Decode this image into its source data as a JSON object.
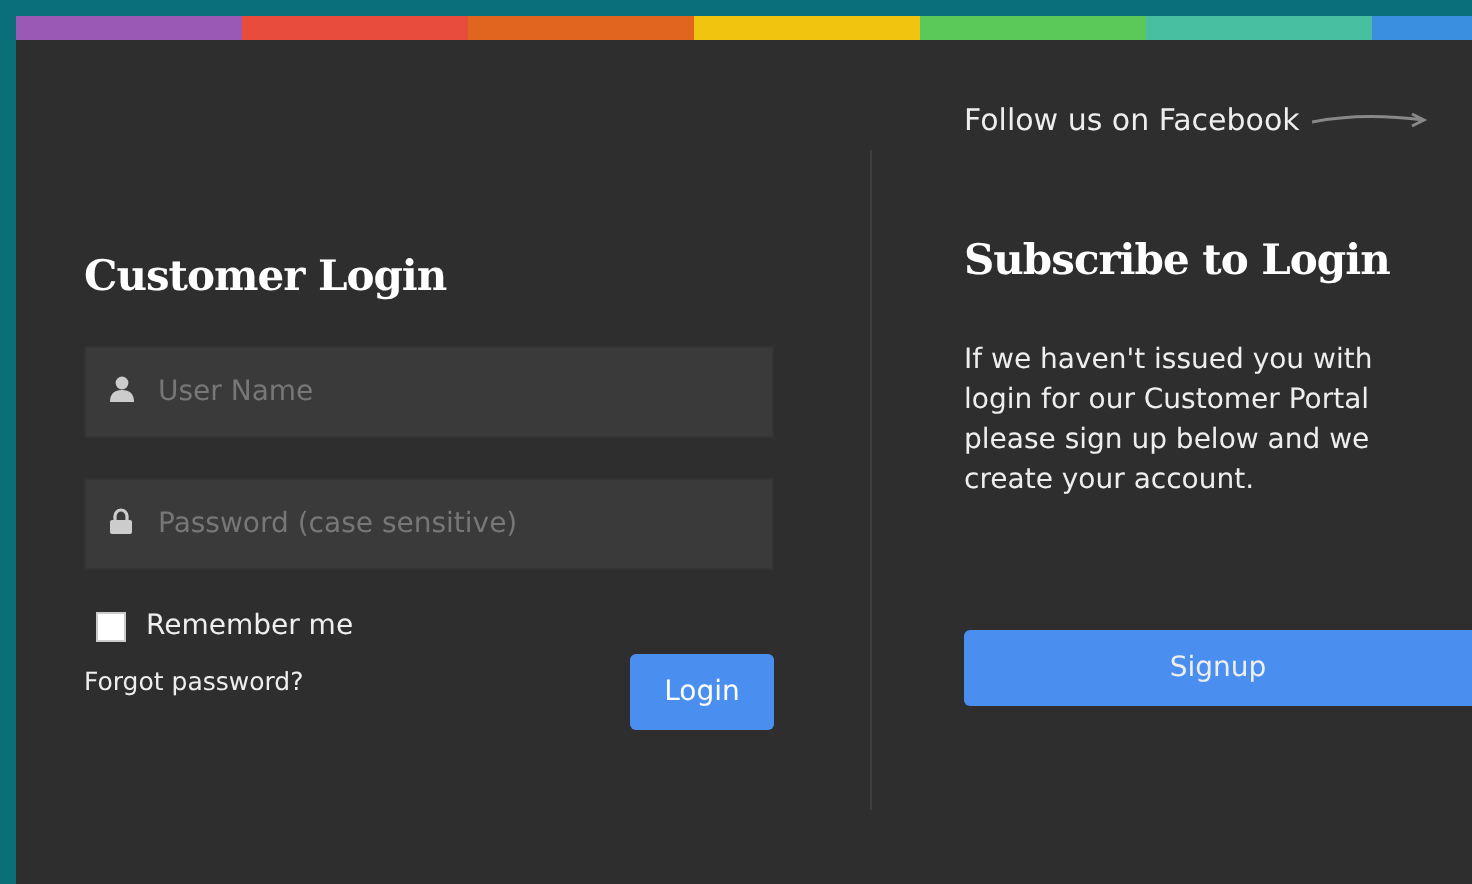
{
  "color_bar": [
    {
      "color": "#9b59b6"
    },
    {
      "color": "#e74c3c"
    },
    {
      "color": "#e0661f"
    },
    {
      "color": "#f1c40f"
    },
    {
      "color": "#5bc85a"
    },
    {
      "color": "#48c0a0"
    },
    {
      "color": "#3a8fe0"
    }
  ],
  "login": {
    "title": "Customer Login",
    "username": {
      "placeholder": "User Name"
    },
    "password": {
      "placeholder": "Password (case sensitive)"
    },
    "remember": {
      "label": "Remember me",
      "checked": false
    },
    "forgot_link": "Forgot password?",
    "button": "Login"
  },
  "subscribe": {
    "follow_text": "Follow us on Facebook",
    "title": "Subscribe to Login",
    "lines": [
      "If we haven't issued you with",
      "login for our Customer Portal",
      "please sign up below and we",
      "create your account."
    ],
    "button": "Signup"
  }
}
